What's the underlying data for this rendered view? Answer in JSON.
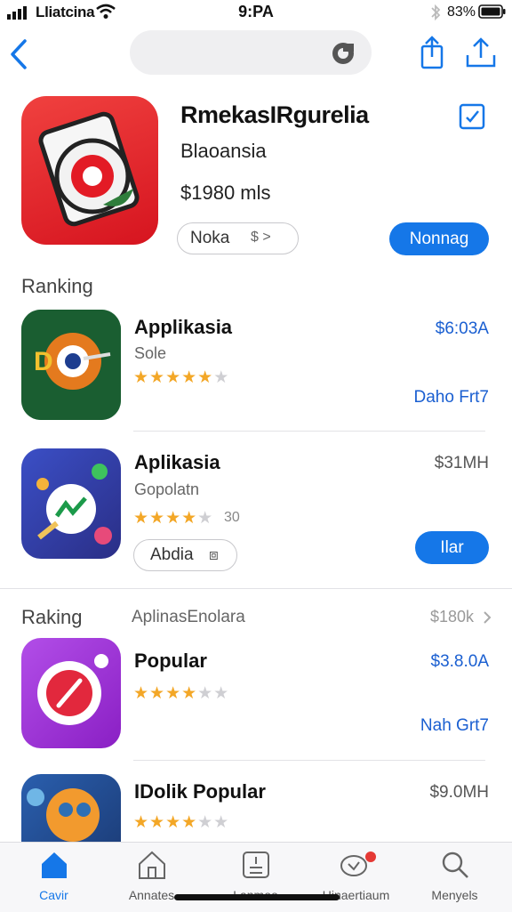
{
  "status_bar": {
    "carrier": "Lliatcina",
    "time": "9:PA",
    "battery": "83%"
  },
  "featured": {
    "title": "RmekasIRgurelia",
    "subtitle": "Blaoansia",
    "price": "$1980 mls",
    "outline_label": "Noka",
    "outline_extra": "$ >",
    "action_label": "Nonnag"
  },
  "sections": {
    "ranking1": "Ranking",
    "ranking2": "Raking",
    "ranking2_mid": "AplinasEnolara",
    "ranking2_price": "$180k"
  },
  "apps": [
    {
      "title": "Applikasia",
      "subtitle": "Sole",
      "price": "$6:03A",
      "meta": "Daho Frt7",
      "stars": 4.5
    },
    {
      "title": "Aplikasia",
      "subtitle": "Gopolatn",
      "price": "$31MH",
      "rating_text": "30",
      "outline_label": "Abdia",
      "action_label": "Ilar",
      "stars": 4
    },
    {
      "title": "Popular",
      "price": "$3.8.0A",
      "meta": "Nah Grt7",
      "stars": 4
    },
    {
      "title": "IDolik Popular",
      "price": "$9.0MH",
      "stars": 4
    }
  ],
  "tabs": [
    {
      "label": "Cavir",
      "active": true
    },
    {
      "label": "Annates"
    },
    {
      "label": "Lanmoo"
    },
    {
      "label": "Uinaertiaum"
    },
    {
      "label": "Menyels"
    }
  ],
  "colors": {
    "accent": "#1577e8",
    "star": "#f3a727",
    "featured_icon": "#e0242b"
  }
}
